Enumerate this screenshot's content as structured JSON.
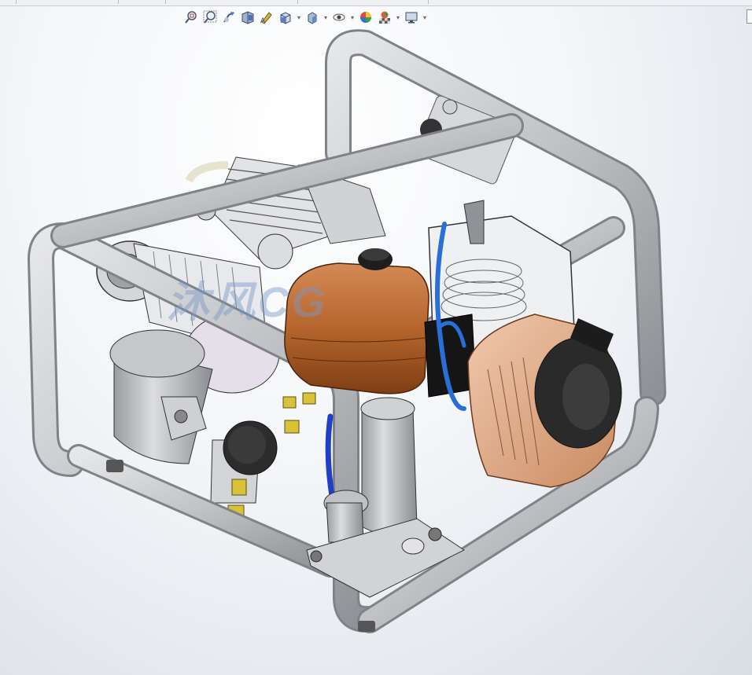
{
  "toolbar": {
    "items": [
      {
        "name": "zoom-to-fit-icon",
        "dropdown": false
      },
      {
        "name": "zoom-to-area-icon",
        "dropdown": false
      },
      {
        "name": "previous-view-icon",
        "dropdown": false
      },
      {
        "name": "section-view-icon",
        "dropdown": false
      },
      {
        "name": "dynamic-annotation-icon",
        "dropdown": false
      },
      {
        "name": "view-orientation-icon",
        "dropdown": true
      },
      {
        "name": "display-style-icon",
        "dropdown": true
      },
      {
        "name": "hide-show-items-icon",
        "dropdown": true
      },
      {
        "name": "edit-appearance-icon",
        "dropdown": false
      },
      {
        "name": "apply-scene-icon",
        "dropdown": true
      },
      {
        "name": "view-settings-icon",
        "dropdown": true
      }
    ]
  },
  "watermark": {
    "text": "沐风CG"
  },
  "colors": {
    "frame": "#bfc1c4",
    "tank": "#b5652c",
    "hose": "#2a6fd8",
    "engine_cover": "#e3b79c",
    "gauge": "#2c2c2c",
    "fitting": "#d8c23a"
  }
}
